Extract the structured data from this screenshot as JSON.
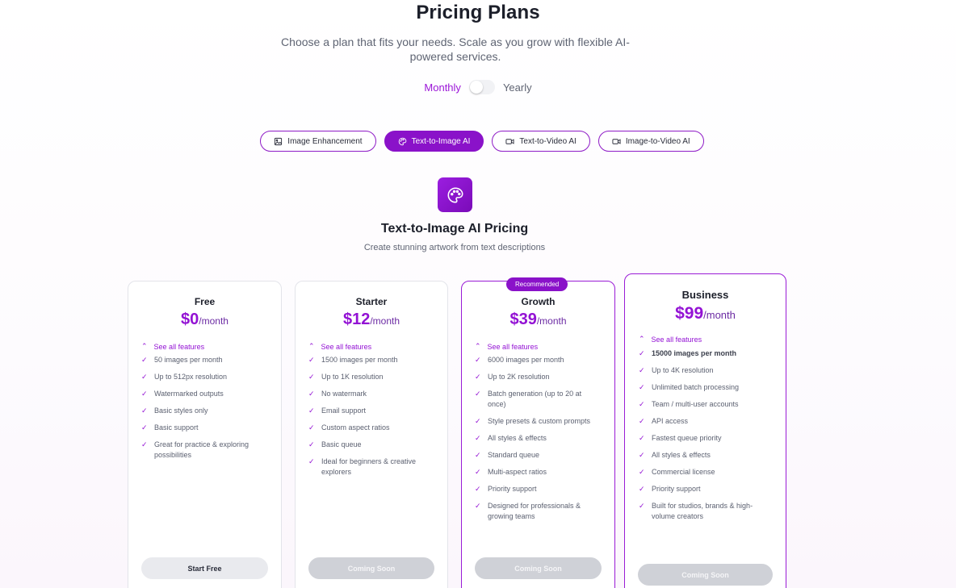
{
  "header": {
    "title": "Pricing Plans",
    "subtitle": "Choose a plan that fits your needs. Scale as you grow with flexible AI-powered services."
  },
  "billing": {
    "monthly_label": "Monthly",
    "yearly_label": "Yearly",
    "selected": "Monthly"
  },
  "tabs": [
    {
      "label": "Image Enhancement",
      "icon": "image-icon"
    },
    {
      "label": "Text-to-Image AI",
      "icon": "palette-icon",
      "active": true
    },
    {
      "label": "Text-to-Video AI",
      "icon": "video-icon"
    },
    {
      "label": "Image-to-Video AI",
      "icon": "video-icon"
    }
  ],
  "category": {
    "icon": "palette-icon",
    "title": "Text-to-Image AI Pricing",
    "description": "Create stunning artwork from text descriptions"
  },
  "accent_color": "#9312d4",
  "plans": [
    {
      "name": "Free",
      "price": "$0",
      "period": "/month",
      "see_all": "See all features",
      "features": [
        "50 images per month",
        "Up to 512px resolution",
        "Watermarked outputs",
        "Basic styles only",
        "Basic support",
        "Great for practice & exploring possibilities"
      ],
      "button": "Start Free"
    },
    {
      "name": "Starter",
      "price": "$12",
      "period": "/month",
      "see_all": "See all features",
      "features": [
        "1500 images per month",
        "Up to 1K resolution",
        "No watermark",
        "Email support",
        "Custom aspect ratios",
        "Basic queue",
        "Ideal for beginners & creative explorers"
      ],
      "button": "Coming Soon"
    },
    {
      "name": "Growth",
      "badge": "Recommended",
      "price": "$39",
      "period": "/month",
      "see_all": "See all features",
      "features": [
        "6000 images per month",
        "Up to 2K resolution",
        "Batch generation (up to 20 at once)",
        "Style presets & custom prompts",
        "All styles & effects",
        "Standard queue",
        "Multi-aspect ratios",
        "Priority support",
        "Designed for professionals & growing teams"
      ],
      "button": "Coming Soon"
    },
    {
      "name": "Business",
      "price": "$99",
      "period": "/month",
      "see_all": "See all features",
      "features": [
        "15000 images per month",
        "Up to 4K resolution",
        "Unlimited batch processing",
        "Team / multi-user accounts",
        "API access",
        "Fastest queue priority",
        "All styles & effects",
        "Commercial license",
        "Priority support",
        "Built for studios, brands & high-volume creators"
      ],
      "button": "Coming Soon"
    }
  ]
}
